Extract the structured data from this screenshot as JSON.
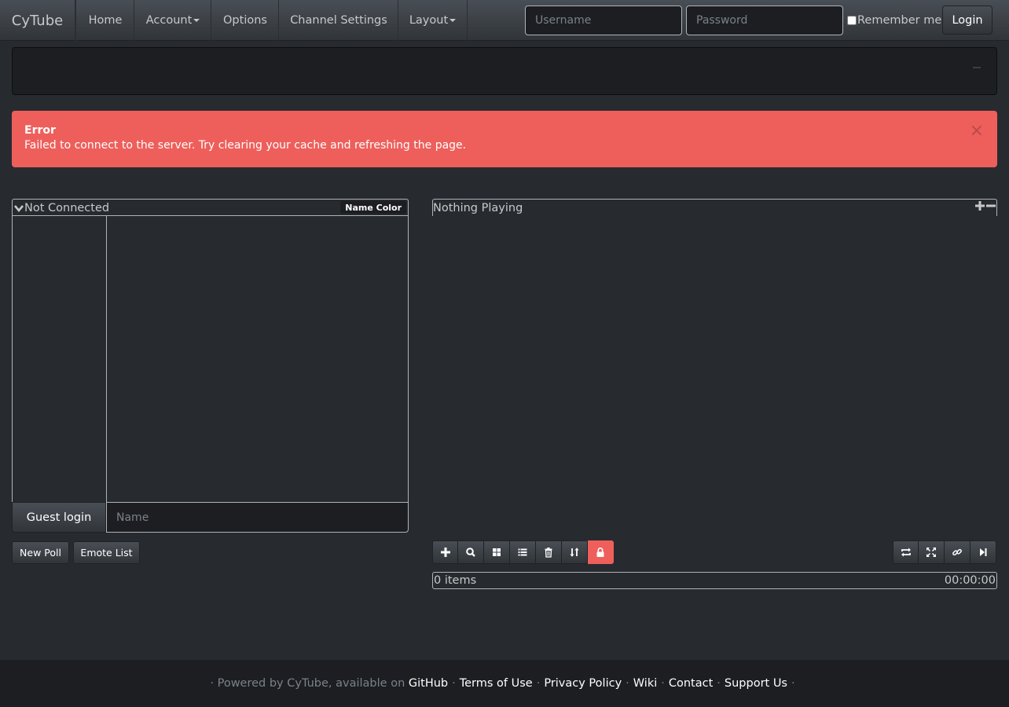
{
  "nav": {
    "brand": "CyTube",
    "home": "Home",
    "account": "Account",
    "options": "Options",
    "channel_settings": "Channel Settings",
    "layout": "Layout",
    "username_placeholder": "Username",
    "password_placeholder": "Password",
    "remember_me": "Remember me",
    "login": "Login"
  },
  "alert": {
    "title": "Error",
    "message": "Failed to connect to the server. Try clearing your cache and refreshing the page.",
    "close": "×"
  },
  "chat": {
    "status": "Not Connected",
    "name_color": "Name Color",
    "guest_login": "Guest login",
    "name_placeholder": "Name",
    "new_poll": "New Poll",
    "emote_list": "Emote List"
  },
  "video": {
    "title": "Nothing Playing"
  },
  "playlist": {
    "item_count": "0 items",
    "duration": "00:00:00",
    "controls": [
      "plus-icon",
      "search-icon",
      "grid-icon",
      "list-icon",
      "trash-icon",
      "sort-icon",
      "lock-icon"
    ],
    "right_controls": [
      "repeat-icon",
      "fullscreen-icon",
      "link-icon",
      "skip-icon"
    ]
  },
  "footer": {
    "powered_by": "· Powered by CyTube, available on",
    "github": "GitHub",
    "terms": "Terms of Use",
    "privacy": "Privacy Policy",
    "wiki": "Wiki",
    "contact": "Contact",
    "support": "Support Us",
    "separator": "·"
  },
  "colors": {
    "background": "#272b30",
    "navbar": "#3a3f44",
    "alert": "#ee5f5b",
    "footer": "#1c1e22"
  }
}
